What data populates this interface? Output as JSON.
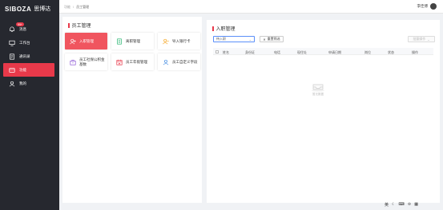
{
  "brand": {
    "logo_text": "SIBOZA",
    "logo_cn": "思博达"
  },
  "nav": {
    "items": [
      {
        "label": "消息",
        "badge": "99+"
      },
      {
        "label": "工作台"
      },
      {
        "label": "通讯录"
      },
      {
        "label": "功能"
      },
      {
        "label": "我的"
      }
    ]
  },
  "breadcrumb": {
    "root": "功能",
    "separator": "/",
    "current": "员工管理"
  },
  "user": {
    "name": "李佳博"
  },
  "left_panel": {
    "title": "员工管理",
    "cards": [
      {
        "label": "入职管理"
      },
      {
        "label": "离职管理"
      },
      {
        "label": "导入银行卡"
      },
      {
        "label": "员工社保公积金基数"
      },
      {
        "label": "员工年假管理"
      },
      {
        "label": "员工自定义字段"
      }
    ]
  },
  "right_panel": {
    "title": "入职管理",
    "search": {
      "value": "待入职"
    },
    "reset_label": "重置筛选",
    "batch_label": "批量操作",
    "columns": [
      "姓名",
      "身份证",
      "电话",
      "现住址",
      "申请日期",
      "岗位",
      "状态",
      "操作"
    ],
    "empty_text": "暂无数据"
  },
  "bottom_icons": [
    "英",
    "moon-icon",
    "keyboard-icon",
    "shirt-icon",
    "grid-icon"
  ],
  "colors": {
    "accent": "#e8394a",
    "sidebar": "#26282f",
    "card_active": "#f0555f"
  }
}
